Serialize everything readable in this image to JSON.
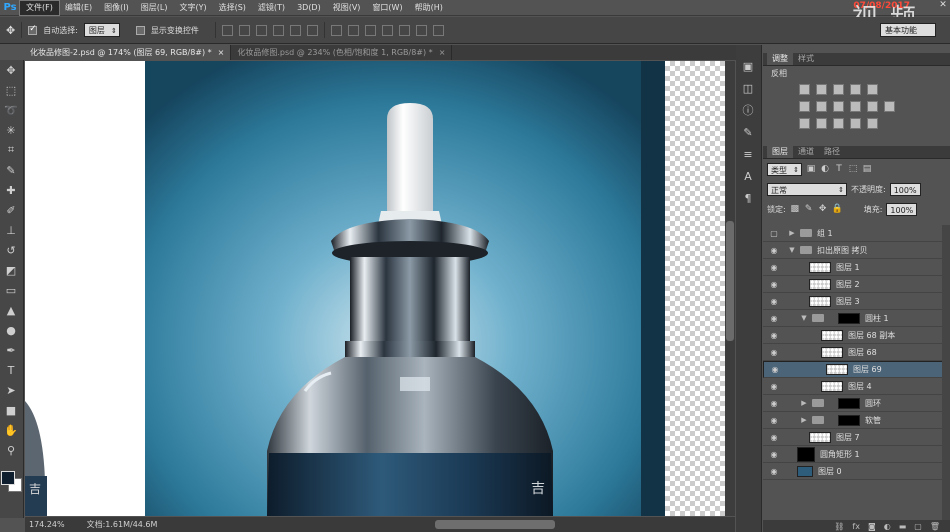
{
  "app": {
    "logo": "Ps",
    "watermark": "视 频",
    "clock": "07/08/2017"
  },
  "menu": [
    "文件(F)",
    "编辑(E)",
    "图像(I)",
    "图层(L)",
    "文字(Y)",
    "选择(S)",
    "滤镜(T)",
    "3D(D)",
    "视图(V)",
    "窗口(W)",
    "帮助(H)"
  ],
  "options": {
    "auto_select_label": "自动选择:",
    "auto_select_value": "图层",
    "show_transform_label": "显示变换控件",
    "workspace": "基本功能"
  },
  "tabs": [
    {
      "label": "化妆品修图-2.psd @ 174% (图层 69, RGB/8#) *",
      "close": "×"
    },
    {
      "label": "化妆品修图.psd @ 234% (色相/饱和度 1, RGB/8#) *",
      "close": "×"
    }
  ],
  "status": {
    "zoom": "174.24%",
    "doc": "文档:1.61M/44.6M"
  },
  "adjust_panel": {
    "tab_adjust": "调整",
    "tab_styles": "样式",
    "title": "反相"
  },
  "layers_panel": {
    "tab_layers": "图层",
    "tab_channels": "通道",
    "tab_paths": "路径",
    "kind": "类型",
    "blend": "正常",
    "opacity_label": "不透明度:",
    "opacity": "100%",
    "lock_label": "锁定:",
    "fill_label": "填充:",
    "fill": "100%"
  },
  "layers": [
    {
      "name": "组 1",
      "type": "group",
      "visible": false,
      "indent": 0
    },
    {
      "name": "扣出原图 拷贝",
      "type": "group-open",
      "visible": true,
      "indent": 0
    },
    {
      "name": "图层 1",
      "type": "layer",
      "visible": true,
      "indent": 1
    },
    {
      "name": "图层 2",
      "type": "layer",
      "visible": true,
      "indent": 1
    },
    {
      "name": "图层 3",
      "type": "layer",
      "visible": true,
      "indent": 1
    },
    {
      "name": "圆柱 1",
      "type": "group-mask-open",
      "visible": true,
      "indent": 1
    },
    {
      "name": "图层 68 副本",
      "type": "layer",
      "visible": true,
      "indent": 2
    },
    {
      "name": "图层 68",
      "type": "layer",
      "visible": true,
      "indent": 2
    },
    {
      "name": "图层 69",
      "type": "layer",
      "visible": true,
      "indent": 2,
      "selected": true
    },
    {
      "name": "图层 4",
      "type": "layer",
      "visible": true,
      "indent": 2
    },
    {
      "name": "圆环",
      "type": "group-mask",
      "visible": true,
      "indent": 1
    },
    {
      "name": "软管",
      "type": "group-mask",
      "visible": true,
      "indent": 1
    },
    {
      "name": "图层 7",
      "type": "layer-linked",
      "visible": true,
      "indent": 1
    },
    {
      "name": "圆角矩形 1",
      "type": "shape",
      "visible": true,
      "indent": 0
    },
    {
      "name": "图层 0",
      "type": "photo",
      "visible": true,
      "indent": 0
    }
  ],
  "canvas_text": {
    "bottle_char": "吉"
  }
}
